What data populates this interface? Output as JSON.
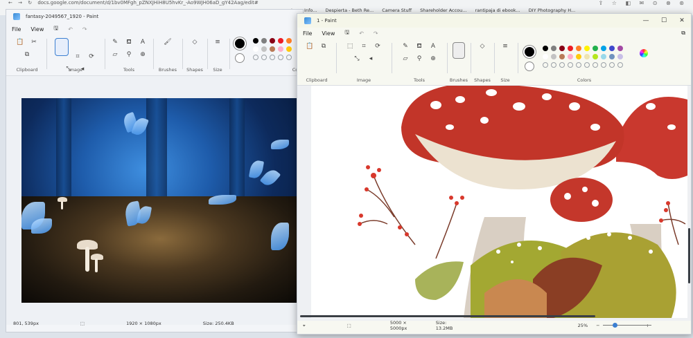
{
  "browser": {
    "url": "docs.google.com/document/d/1bv0MFgh_pZNXJHiH8U5hvKr_-Ao9WJH06aD_gY42Aag/edit#",
    "bookmarks": [
      "Insce Info...",
      "Despierta - Beth Re...",
      "Camera Stuff",
      "Shareholder Accou...",
      "rantipaja di ebook...",
      "DIY Photography H..."
    ]
  },
  "window1": {
    "title": "fantasy-2049567_1920 - Paint",
    "menu": [
      "File",
      "View"
    ],
    "groups": {
      "clipboard": "Clipboard",
      "image": "Image",
      "tools": "Tools",
      "brushes": "Brushes",
      "shapes": "Shapes",
      "size": "Size",
      "colors": "Co"
    },
    "status": {
      "cursor": "801, 539px",
      "dimensions": "1920 × 1080px",
      "size": "Size: 250.4KB"
    }
  },
  "window2": {
    "title": "1 - Paint",
    "menu": [
      "File",
      "View"
    ],
    "groups": {
      "clipboard": "Clipboard",
      "image": "Image",
      "tools": "Tools",
      "brushes": "Brushes",
      "shapes": "Shapes",
      "size": "Size",
      "colors": "Colors"
    },
    "status": {
      "dimensions": "5000 × 5000px",
      "size": "Size: 13.2MB",
      "zoom": "25%"
    },
    "controls": {
      "minimize": "—",
      "maximize": "☐",
      "close": "✕"
    }
  },
  "palette": {
    "primary": "#000000",
    "secondary": "#ffffff",
    "row1": [
      "#000000",
      "#7f7f7f",
      "#880015",
      "#ed1c24",
      "#ff7f27",
      "#fff200",
      "#22b14c",
      "#00a2e8",
      "#3f48cc",
      "#a349a4"
    ],
    "row2": [
      "#ffffff",
      "#c3c3c3",
      "#b97a57",
      "#ffaec9",
      "#ffc90e",
      "#efe4b0",
      "#b5e61d",
      "#99d9ea",
      "#7092be",
      "#c8bfe7"
    ]
  },
  "colors": {
    "accent": "#3b7fd1",
    "window_bg": "#f8f9fb"
  }
}
